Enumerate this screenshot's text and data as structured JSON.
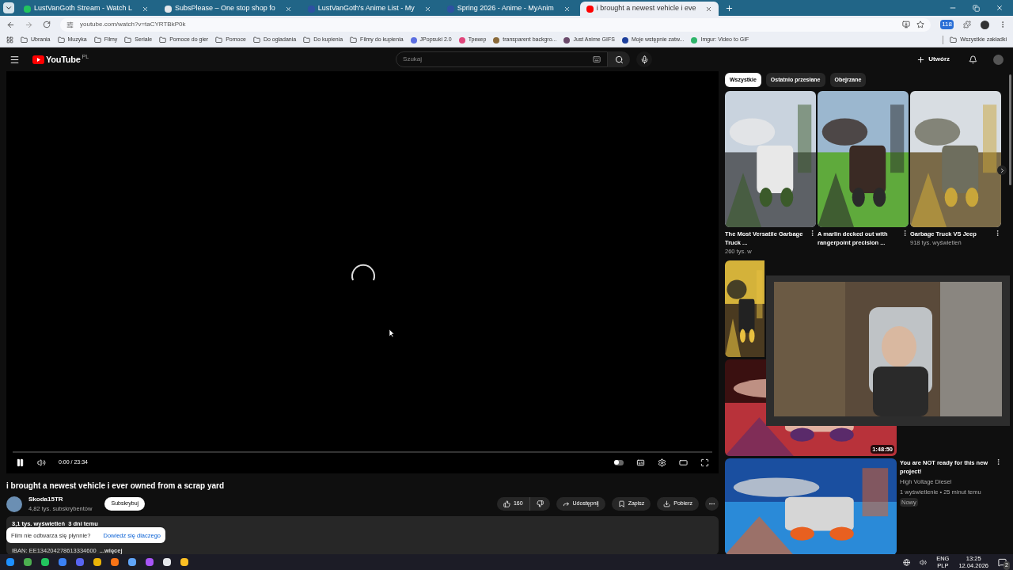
{
  "browser": {
    "tabs": [
      {
        "title": "LustVanGoth Stream - Watch L",
        "selected": false
      },
      {
        "title": "SubsPlease – One stop shop fo",
        "selected": false
      },
      {
        "title": "LustVanGoth's Anime List - My",
        "selected": false
      },
      {
        "title": "Spring 2026 - Anime - MyAnim",
        "selected": false
      },
      {
        "title": "i brought a newest vehicle i eve",
        "selected": true
      }
    ],
    "url": "youtube.com/watch?v=taCYRTBkP0k",
    "extension_badge": "118",
    "bookmarks": [
      {
        "label": "Ubrania",
        "kind": "folder"
      },
      {
        "label": "Muzyka",
        "kind": "folder"
      },
      {
        "label": "Filmy",
        "kind": "folder"
      },
      {
        "label": "Seriale",
        "kind": "folder"
      },
      {
        "label": "Pomoce do gier",
        "kind": "folder"
      },
      {
        "label": "Pomoce",
        "kind": "folder"
      },
      {
        "label": "Do ogladania",
        "kind": "folder"
      },
      {
        "label": "Do kupienia",
        "kind": "folder"
      },
      {
        "label": "Filmy do kupienia",
        "kind": "folder"
      },
      {
        "label": "JPopsuki 2.0",
        "kind": "site",
        "color": "#5b6ee1"
      },
      {
        "label": "Трекер",
        "kind": "site",
        "color": "#e0457b"
      },
      {
        "label": "transparent backgro...",
        "kind": "site",
        "color": "#8a6a3a"
      },
      {
        "label": "Just Anime GIFS",
        "kind": "site",
        "color": "#6b4a6b"
      },
      {
        "label": "Moje wstępnie zatw...",
        "kind": "site",
        "color": "#1d3f9c"
      },
      {
        "label": "Imgur: Video to GIF",
        "kind": "site",
        "color": "#2fb56b"
      }
    ],
    "all_bookmarks": "Wszystkie zakładki"
  },
  "youtube": {
    "logo": "YouTube",
    "region": "PL",
    "search_placeholder": "Szukaj",
    "create": "Utwórz",
    "player": {
      "time": "0:00 / 23:34",
      "level": 0,
      "autoplay": false
    },
    "video": {
      "title": "i brought a newest vehicle i ever owned from a scrap yard",
      "channel": "Skoda15TR",
      "subscribers": "4,82 tys. subskrybentów",
      "subscribe": "Subskrybuj",
      "likes": "160",
      "actions": [
        "Udostępnij",
        "Zapisz",
        "Pobierz"
      ],
      "stats": "3,1 tys. wyświetleń  3 dni temu",
      "description": "IBAN: EE134204278613334600",
      "more": "...więcej"
    },
    "toast": {
      "text": "Film nie odtwarza się płynnie?",
      "link": "Dowiedz się dlaczego"
    },
    "chips": [
      {
        "label": "Wszystkie",
        "selected": true
      },
      {
        "label": "Ostatnio przesłane",
        "selected": false
      },
      {
        "label": "Obejrzane",
        "selected": false
      }
    ],
    "shorts": [
      {
        "title": "The Most Versatile Garbage Truck ...",
        "meta": "260 tys. w"
      },
      {
        "title": "A marlin decked out with rangerpoint precision ..."
      },
      {
        "title": "Garbage Truck VS Jeep",
        "meta": "918 tys. wyświetleń"
      }
    ],
    "videos": [
      {
        "duration": "1:48:50"
      },
      {
        "title": "You are NOT ready for this new project!",
        "channel": "High Voltage Diesel",
        "meta": "1 wyświetlenie • 25 minut temu",
        "badge": "Nowy"
      }
    ]
  },
  "taskbar": {
    "language": "ENG",
    "layout": "PLP",
    "time": "13:25",
    "date": "12.04.2026",
    "notifications": "2"
  }
}
